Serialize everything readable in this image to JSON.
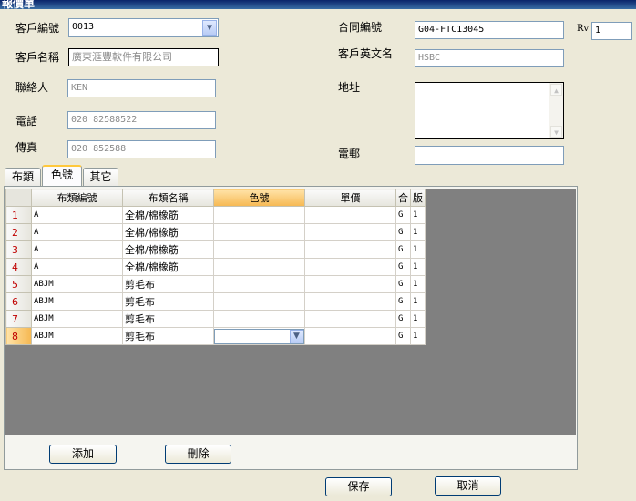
{
  "window": {
    "title": "報價單"
  },
  "form": {
    "customer_no": {
      "label": "客戶編號",
      "value": "0013"
    },
    "customer_name": {
      "label": "客戶名稱",
      "value": "廣東滙豐軟件有限公司"
    },
    "contact": {
      "label": "聯絡人",
      "value": "KEN"
    },
    "phone": {
      "label": "電話",
      "value": "020 82588522"
    },
    "fax": {
      "label": "傳真",
      "value": "020 852588"
    },
    "contract_no": {
      "label": "合同編號",
      "value": "G04-FTC13045"
    },
    "rv": {
      "label": "Rv",
      "value": "1"
    },
    "customer_en": {
      "label": "客戶英文名",
      "value": "HSBC"
    },
    "address": {
      "label": "地址",
      "value": ""
    },
    "email": {
      "label": "電郵",
      "value": ""
    }
  },
  "tabs": [
    {
      "label": "布類"
    },
    {
      "label": "色號"
    },
    {
      "label": "其它"
    }
  ],
  "grid": {
    "headers": [
      "布類編號",
      "布類名稱",
      "色號",
      "單價",
      "合",
      "版"
    ],
    "rows": [
      {
        "num": "1",
        "code": "A",
        "name": "全棉/棉橡筋",
        "color": "",
        "price": "",
        "he": "G",
        "ban": "1"
      },
      {
        "num": "2",
        "code": "A",
        "name": "全棉/棉橡筋",
        "color": "",
        "price": "",
        "he": "G",
        "ban": "1"
      },
      {
        "num": "3",
        "code": "A",
        "name": "全棉/棉橡筋",
        "color": "",
        "price": "",
        "he": "G",
        "ban": "1"
      },
      {
        "num": "4",
        "code": "A",
        "name": "全棉/棉橡筋",
        "color": "",
        "price": "",
        "he": "G",
        "ban": "1"
      },
      {
        "num": "5",
        "code": "ABJM",
        "name": "剪毛布",
        "color": "",
        "price": "",
        "he": "G",
        "ban": "1"
      },
      {
        "num": "6",
        "code": "ABJM",
        "name": "剪毛布",
        "color": "",
        "price": "",
        "he": "G",
        "ban": "1"
      },
      {
        "num": "7",
        "code": "ABJM",
        "name": "剪毛布",
        "color": "",
        "price": "",
        "he": "G",
        "ban": "1"
      },
      {
        "num": "8",
        "code": "ABJM",
        "name": "剪毛布",
        "color": "",
        "price": "",
        "he": "G",
        "ban": "1"
      }
    ]
  },
  "buttons": {
    "add": "添加",
    "delete": "刪除",
    "save": "保存",
    "cancel": "取消"
  },
  "icons": {
    "combo_arrow": "chevron-down-icon",
    "scroll_up": "scroll-up-icon",
    "scroll_down": "scroll-down-icon"
  },
  "colors": {
    "window_bg": "#ece9d8",
    "selected_header": "#f6b851",
    "row_number": "#c00000",
    "grid_empty": "#808080"
  }
}
